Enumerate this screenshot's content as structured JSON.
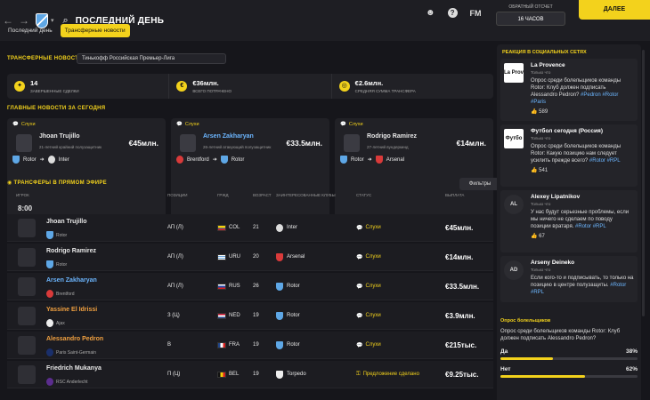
{
  "header": {
    "title": "ПОСЛЕДНИЙ ДЕНЬ",
    "countdown_label": "ОБРАТНЫЙ ОТСЧЕТ",
    "countdown_value": "16 ЧАСОВ",
    "next_label": "ДАЛЕЕ",
    "fm_label": "FM",
    "help_label": "?"
  },
  "tabs": [
    {
      "label": "Последний день"
    },
    {
      "label": "Трансферные новости"
    }
  ],
  "transfer_news": {
    "title": "ТРАНСФЕРНЫЕ НОВОСТИ",
    "league": "Тинькофф Российская Премьер-Лига"
  },
  "stats": [
    {
      "value": "14",
      "label": "ЗАВЕРШЕННЫЕ СДЕЛКИ"
    },
    {
      "value": "€36млн.",
      "label": "ВСЕГО ПОТРАЧЕНО"
    },
    {
      "value": "€2.6млн.",
      "label": "СРЕДНЯЯ СУММА ТРАНСФЕРА"
    }
  ],
  "top_news_title": "ГЛАВНЫЕ НОВОСТИ ЗА СЕГОДНЯ",
  "news": [
    {
      "tag": "Слухи",
      "name": "Jhoan Trujillo",
      "desc": "21-летний крайний полузащитник",
      "fee": "€45млн.",
      "from": "Rotor",
      "to": "Inter"
    },
    {
      "tag": "Слухи",
      "name": "Arsen Zakharyan",
      "desc": "26-летний атакующий полузащитник",
      "fee": "€33.5млн.",
      "from": "Brentford",
      "to": "Rotor"
    },
    {
      "tag": "Слухи",
      "name": "Rodrigo Ramirez",
      "desc": "27-летний вундеркинд",
      "fee": "€14млн.",
      "from": "Rotor",
      "to": "Arsenal"
    }
  ],
  "live": {
    "title": "ТРАНСФЕРЫ В ПРЯМОМ ЭФИРЕ",
    "filters": "Фильтры",
    "time": "8:00",
    "columns": [
      "ИГРОК",
      "ПОЗИЦИИ",
      "ГРЖД",
      "ВОЗРАСТ",
      "ЗАИНТЕРЕСОВАННЫЕ КЛУБЫ",
      "СТАТУС",
      "ВЫПЛАТА"
    ]
  },
  "rows": [
    {
      "name": "Jhoan Trujillo",
      "club": "Rotor",
      "pos": "АП (Л)",
      "nat": "COL",
      "age": "21",
      "interest": "Inter",
      "status": "Слухи",
      "fee": "€45млн."
    },
    {
      "name": "Rodrigo Ramirez",
      "club": "Rotor",
      "pos": "АП (Л)",
      "nat": "URU",
      "age": "20",
      "interest": "Arsenal",
      "status": "Слухи",
      "fee": "€14млн."
    },
    {
      "name": "Arsen Zakharyan",
      "club": "Brentford",
      "pos": "АП (Л)",
      "nat": "RUS",
      "age": "26",
      "interest": "Rotor",
      "status": "Слухи",
      "fee": "€33.5млн."
    },
    {
      "name": "Yassine El Idrissi",
      "club": "Ajax",
      "pos": "З (Ц)",
      "nat": "NED",
      "age": "19",
      "interest": "Rotor",
      "status": "Слухи",
      "fee": "€3.9млн."
    },
    {
      "name": "Alessandro Pedron",
      "club": "Paris Saint-Germain",
      "pos": "В",
      "nat": "FRA",
      "age": "19",
      "interest": "Rotor",
      "status": "Слухи",
      "fee": "€215тыс."
    },
    {
      "name": "Friedrich Mukanya",
      "club": "RSC Anderlecht",
      "pos": "П (Ц)",
      "nat": "BEL",
      "age": "19",
      "interest": "Torpedo",
      "status": "Предложение сделано",
      "fee": "€9.25тыс."
    }
  ],
  "social": {
    "title": "РЕАКЦИЯ В СОЦИАЛЬНЫХ СЕТЯХ",
    "posts": [
      {
        "avatar": "La Prov",
        "author": "La Provence",
        "time": "Только что",
        "text": "Опрос среди болельщиков команды Rotor: Клуб должен подписать Alessandro Pedron?",
        "tags": "#Pedron #Rotor #Paris",
        "likes": "589"
      },
      {
        "avatar": "Футбо",
        "author": "Футбол сегодня (Россия)",
        "time": "Только что",
        "text": "Опрос среди болельщиков команды Rotor: Какую позицию нам следует усилить прежде всего?",
        "tags": "#Rotor #RPL",
        "likes": "541"
      },
      {
        "avatar": "AL",
        "author": "Alexey Lipatnikov",
        "time": "Только что",
        "text": "У нас будут серьезные проблемы, если мы ничего не сделаем по поводу позиции вратаря.",
        "tags": "#Rotor #RPL",
        "likes": "67"
      },
      {
        "avatar": "AD",
        "author": "Arseny Deineko",
        "time": "Только что",
        "text": "Если кого-то и подписывать, то только на позицию в центре полузащиты.",
        "tags": "#Rotor #RPL",
        "likes": ""
      }
    ]
  },
  "poll": {
    "title": "Опрос болельщиков",
    "question": "Опрос среди болельщиков команды Rotor: Клуб должен подписать Alessandro Pedron?",
    "options": [
      {
        "label": "Да",
        "pct": "38%",
        "value": 38
      },
      {
        "label": "Нет",
        "pct": "62%",
        "value": 62
      }
    ]
  }
}
